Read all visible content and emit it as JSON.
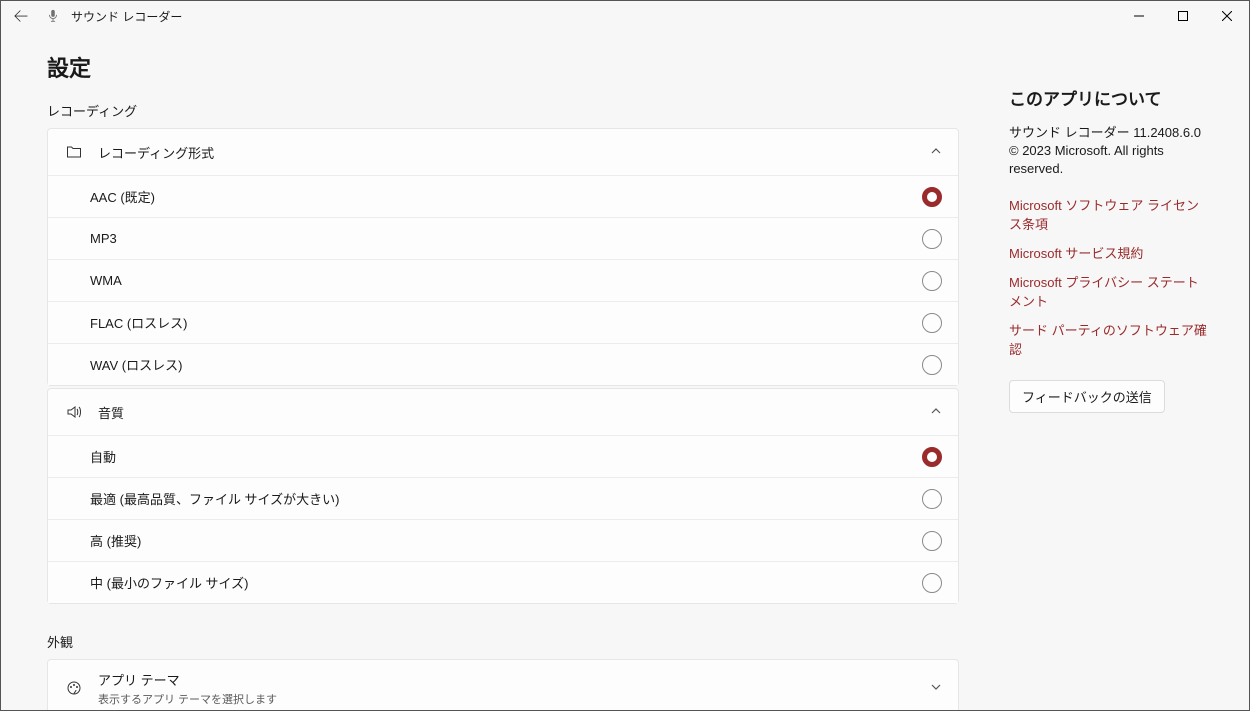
{
  "titlebar": {
    "app_name": "サウンド レコーダー"
  },
  "page": {
    "title": "設定",
    "section_recording": "レコーディング",
    "section_appearance": "外観"
  },
  "recording_format": {
    "label": "レコーディング形式",
    "options": [
      {
        "label": "AAC (既定)",
        "checked": true
      },
      {
        "label": "MP3",
        "checked": false
      },
      {
        "label": "WMA",
        "checked": false
      },
      {
        "label": "FLAC (ロスレス)",
        "checked": false
      },
      {
        "label": "WAV (ロスレス)",
        "checked": false
      }
    ]
  },
  "quality": {
    "label": "音質",
    "options": [
      {
        "label": "自動",
        "checked": true
      },
      {
        "label": "最適 (最高品質、ファイル サイズが大きい)",
        "checked": false
      },
      {
        "label": "高 (推奨)",
        "checked": false
      },
      {
        "label": "中 (最小のファイル サイズ)",
        "checked": false
      }
    ]
  },
  "theme": {
    "label": "アプリ テーマ",
    "sub": "表示するアプリ テーマを選択します"
  },
  "about": {
    "title": "このアプリについて",
    "version": "サウンド レコーダー 11.2408.6.0",
    "copyright": "© 2023 Microsoft. All rights reserved.",
    "links": [
      "Microsoft ソフトウェア ライセンス条項",
      "Microsoft サービス規約",
      "Microsoft プライバシー ステートメント",
      "サード パーティのソフトウェア確認"
    ],
    "feedback": "フィードバックの送信"
  }
}
